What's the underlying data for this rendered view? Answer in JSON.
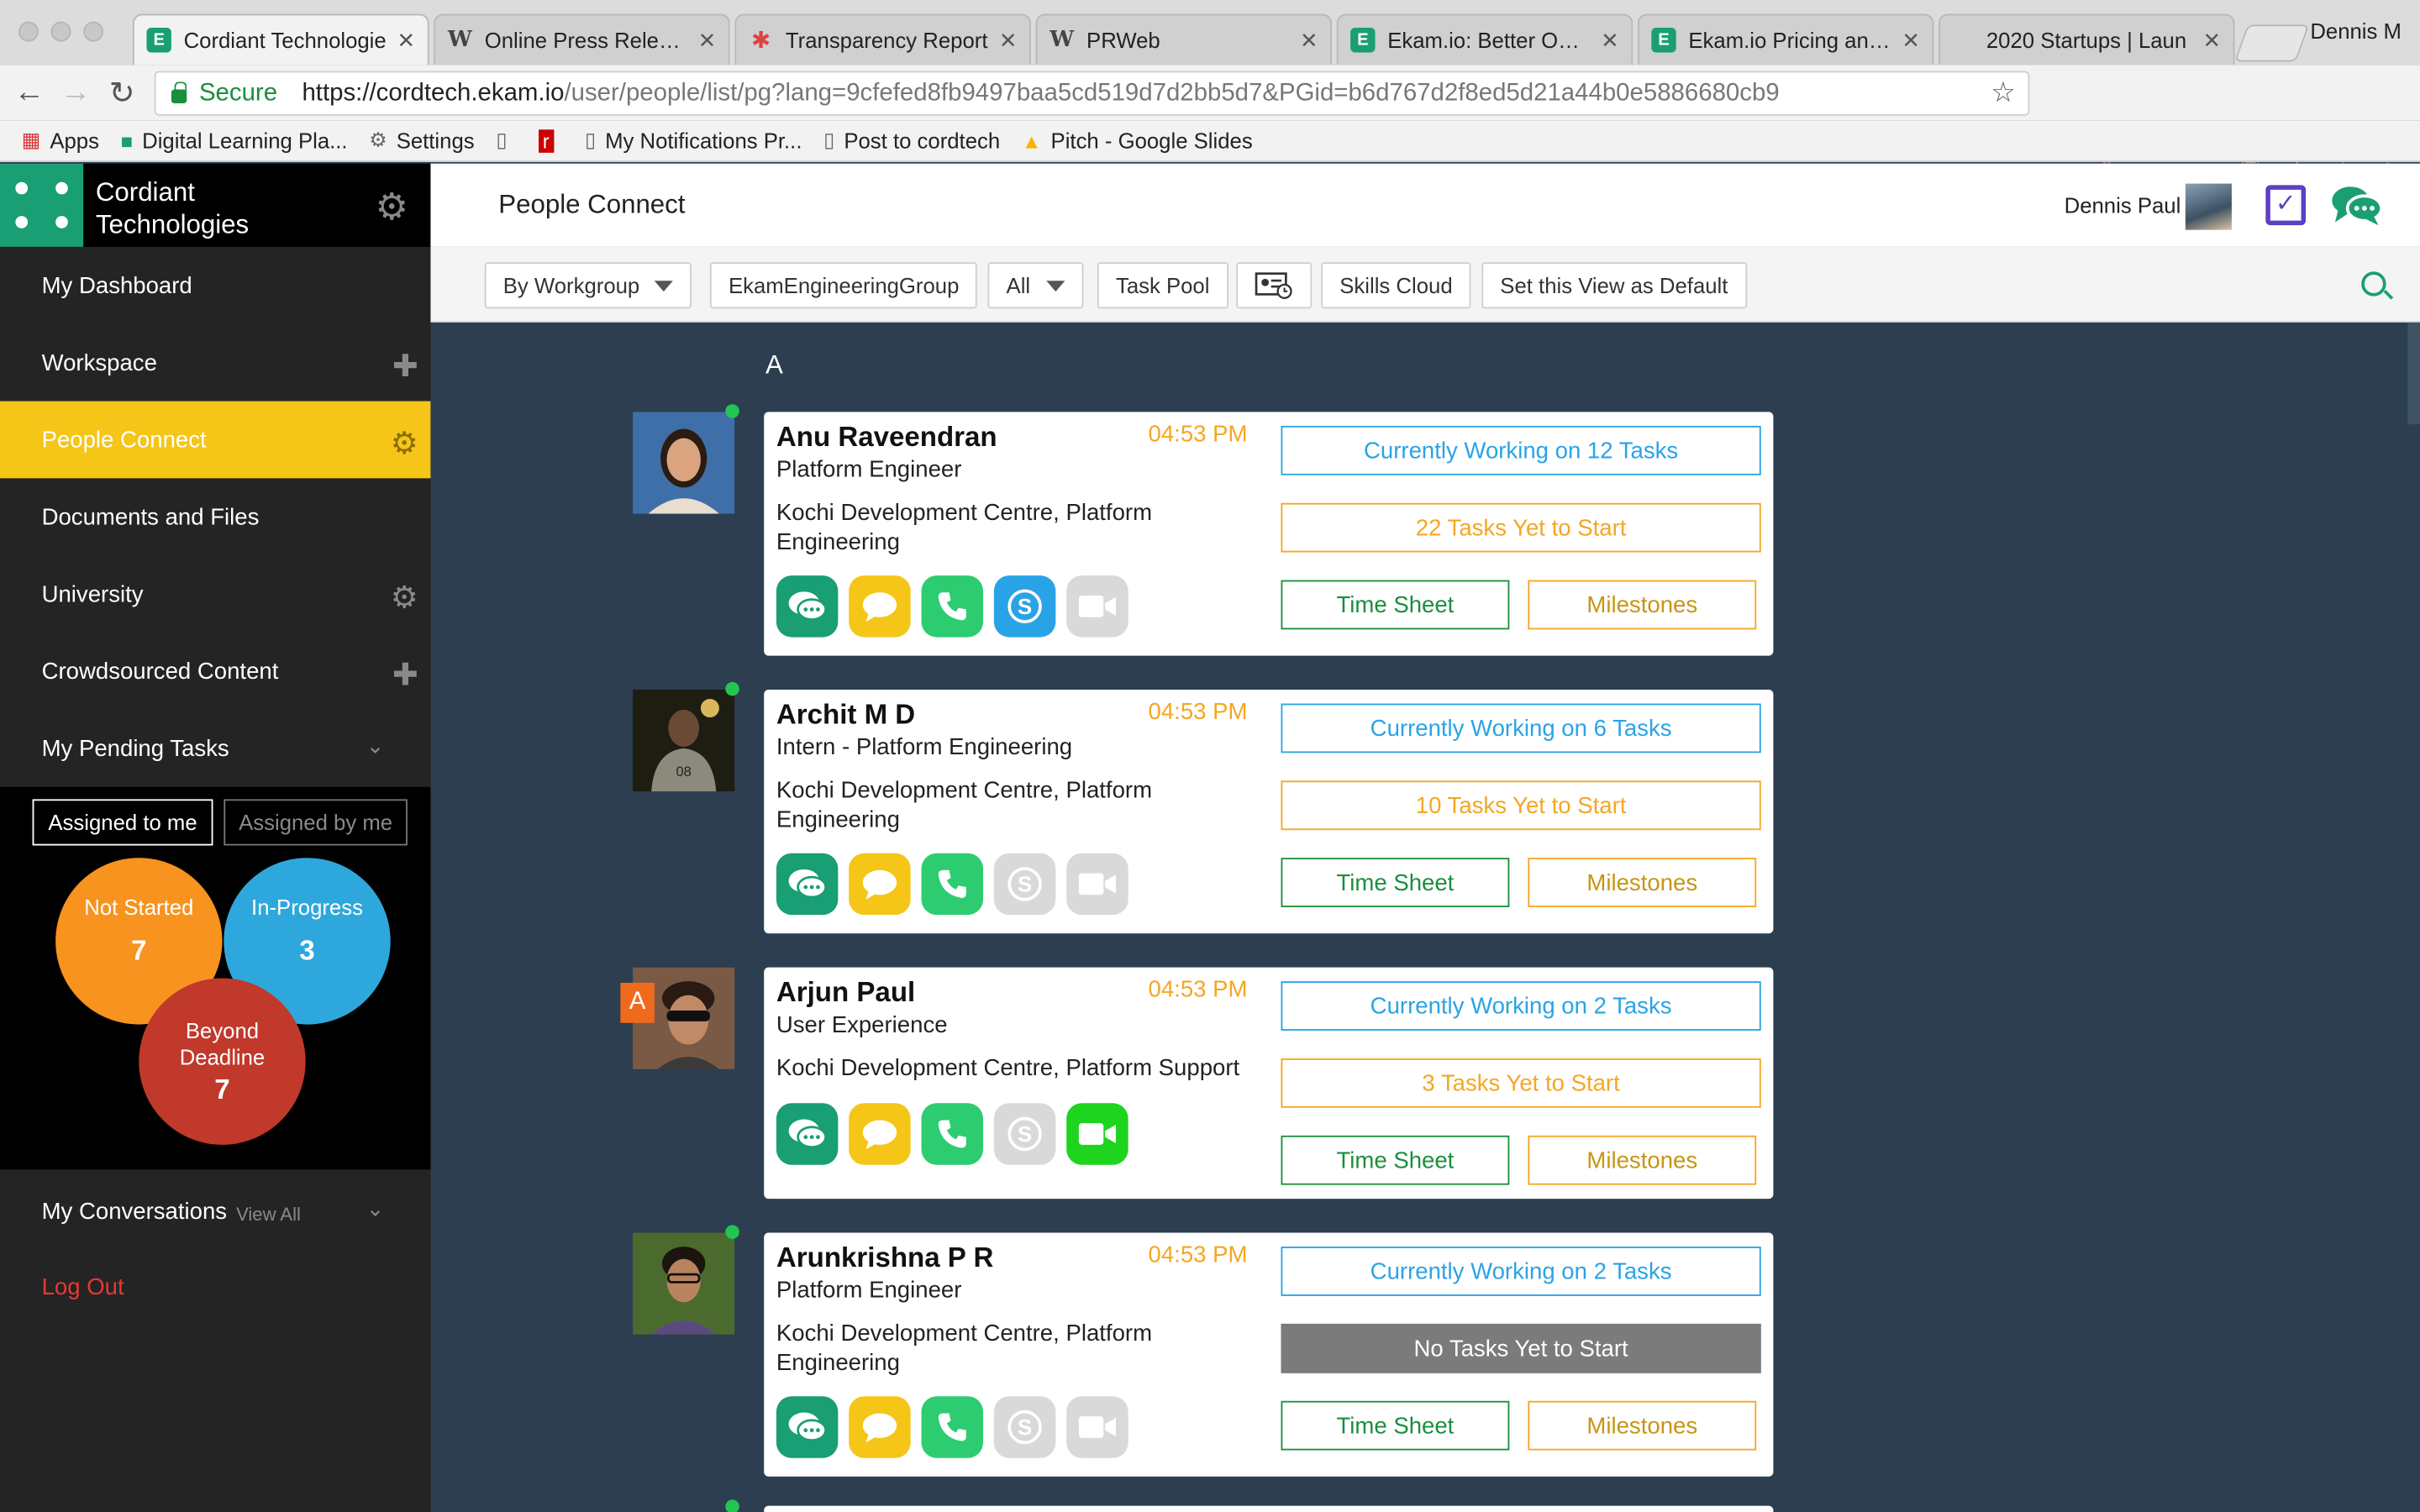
{
  "browser": {
    "tabs": [
      {
        "title": "Cordiant Technologie",
        "icon": "ekam-icon",
        "active": true
      },
      {
        "title": "Online Press Release",
        "icon": "w-icon"
      },
      {
        "title": "Transparency Report",
        "icon": "slack-icon"
      },
      {
        "title": "PRWeb",
        "icon": "w-icon"
      },
      {
        "title": "Ekam.io: Better Outco",
        "icon": "ekam-icon"
      },
      {
        "title": "Ekam.io Pricing and S",
        "icon": "ekam-icon"
      },
      {
        "title": "2020 Startups | Laun",
        "icon": "none"
      }
    ],
    "profile_name": "Dennis M",
    "secure_label": "Secure",
    "url_host": "https://cordtech.ekam.io",
    "url_path": "/user/people/list/pg?lang=9cfefed8fb9497baa5cd519d7d2bb5d7&PGid=b6d767d2f8ed5d21a44b0e5886680cb9",
    "bookmarks": [
      "Apps",
      "Digital Learning Pla...",
      "Settings",
      "",
      "",
      "My Notifications Pr...",
      "Post to cordtech",
      "Pitch - Google Slides"
    ]
  },
  "sidebar": {
    "brand_line1": "Cordiant",
    "brand_line2": "Technologies",
    "nav": {
      "dashboard": "My Dashboard",
      "workspace": "Workspace",
      "people": "People Connect",
      "documents": "Documents and Files",
      "university": "University",
      "crowdsourced": "Crowdsourced Content",
      "pending": "My Pending Tasks",
      "conversations": "My Conversations"
    },
    "view_all": "View All",
    "pending_tabs": {
      "assigned_to": "Assigned to me",
      "assigned_by": "Assigned by me"
    },
    "bubbles": {
      "not_started": {
        "label": "Not Started",
        "count": "7"
      },
      "in_progress": {
        "label": "In-Progress",
        "count": "3"
      },
      "beyond_l1": "Beyond",
      "beyond_l2": "Deadline",
      "beyond_count": "7"
    },
    "logout": "Log Out"
  },
  "header": {
    "title": "People Connect",
    "user_name": "Dennis Paul"
  },
  "toolbar": {
    "workgroup": "By Workgroup",
    "group": "EkamEngineeringGroup",
    "filter": "All",
    "task_pool": "Task Pool",
    "skills": "Skills Cloud",
    "set_default": "Set this View as Default"
  },
  "list": {
    "letter": "A",
    "people": [
      {
        "name": "Anu Raveendran",
        "time": "04:53 PM",
        "role": "Platform Engineer",
        "location": "Kochi Development Centre, Platform Engineering",
        "working": "Currently Working on 12 Tasks",
        "yet": "22 Tasks Yet to Start",
        "timesheet": "Time Sheet",
        "milestones": "Milestones"
      },
      {
        "name": "Archit M D",
        "time": "04:53 PM",
        "role": "Intern - Platform Engineering",
        "location": "Kochi Development Centre, Platform Engineering",
        "working": "Currently Working on 6 Tasks",
        "yet": "10 Tasks Yet to Start",
        "timesheet": "Time Sheet",
        "milestones": "Milestones"
      },
      {
        "name": "Arjun Paul",
        "time": "04:53 PM",
        "role": "User Experience",
        "location": "Kochi Development Centre, Platform Support",
        "working": "Currently Working on 2 Tasks",
        "yet": "3 Tasks Yet to Start",
        "timesheet": "Time Sheet",
        "milestones": "Milestones",
        "badge": "A"
      },
      {
        "name": "Arunkrishna P R",
        "time": "04:53 PM",
        "role": "Platform Engineer",
        "location": "Kochi Development Centre, Platform Engineering",
        "working": "Currently Working on 2 Tasks",
        "yet": "No Tasks Yet to Start",
        "timesheet": "Time Sheet",
        "milestones": "Milestones"
      }
    ]
  },
  "colors": {
    "brand": "#1a9e74",
    "active_nav": "#f5c518",
    "content_bg": "#2c3e50",
    "working_blue": "#29a3e6",
    "pending_orange": "#f5a623",
    "beyond_red": "#c0392b"
  }
}
